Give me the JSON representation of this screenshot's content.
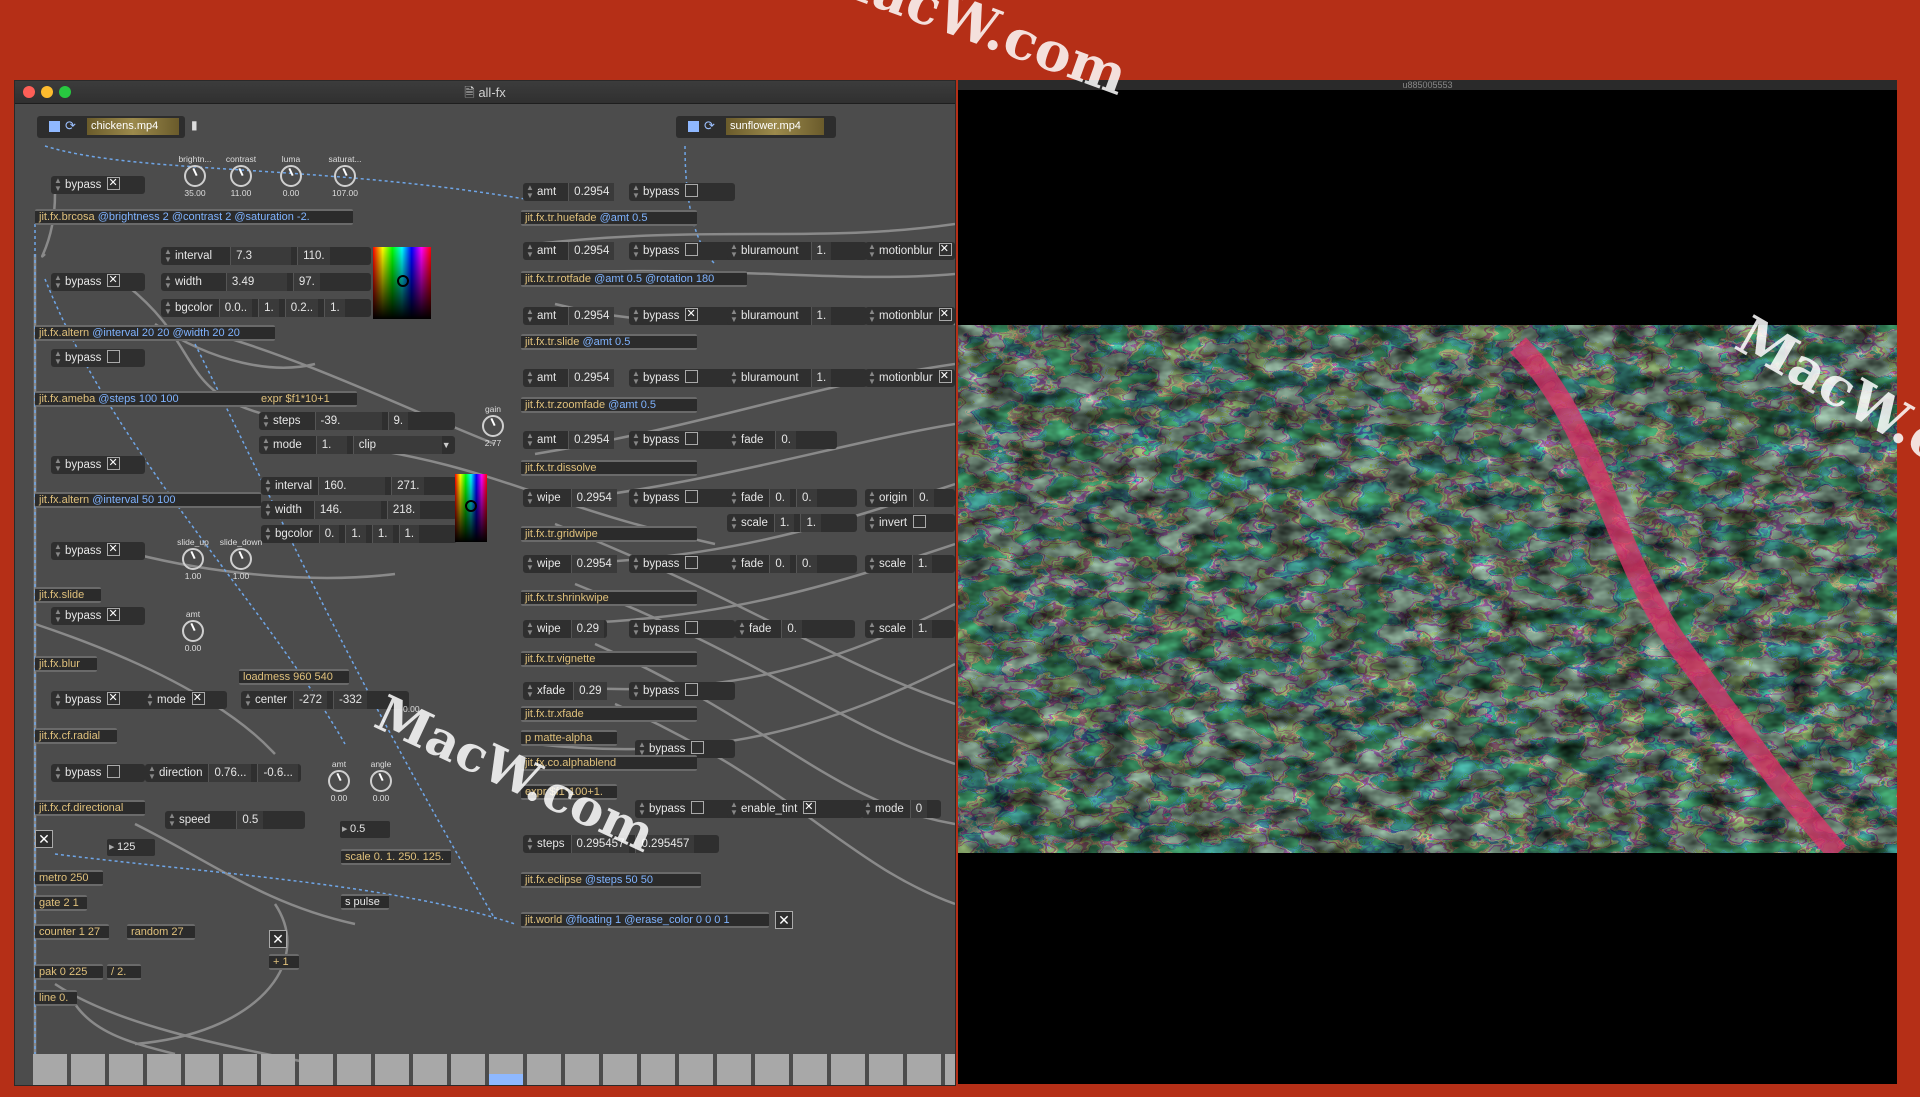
{
  "window": {
    "title": "all-fx",
    "viewer_title": "u885005553"
  },
  "watermark": "MacW.com",
  "players": [
    {
      "file": "chickens.mp4"
    },
    {
      "file": "sunflower.mp4"
    }
  ],
  "dials_top": [
    {
      "label": "brightn...",
      "value": "35.00"
    },
    {
      "label": "contrast",
      "value": "11.00"
    },
    {
      "label": "luma",
      "value": "0.00"
    },
    {
      "label": "saturat...",
      "value": "107.00"
    }
  ],
  "left_chain": {
    "bypass": "bypass",
    "brcosa": {
      "name": "jit.fx.brcosa",
      "attrs": " @brightness 2 @contrast 2 @saturation -2."
    },
    "interval_label": "interval",
    "interval_a": "7.3",
    "interval_b": "110.",
    "width_label": "width",
    "width_a": "3.49",
    "width_b": "97.",
    "bgcolor_label": "bgcolor",
    "bgcolor_a": "0.0..",
    "bgcolor_b": "1.",
    "bgcolor_c": "0.2..",
    "bgcolor_d": "1.",
    "altern1": {
      "name": "jit.fx.altern",
      "attrs": " @interval 20 20 @width 20 20"
    },
    "ameba": {
      "name": "jit.fx.ameba",
      "attrs": " @steps 100 100"
    },
    "expr1": "expr $f1*10+1",
    "steps_label": "steps",
    "steps_a": "-39.",
    "steps_b": "9.",
    "mode_label": "mode",
    "mode_a": "1.",
    "mode_b": "clip",
    "gain_label": "gain",
    "gain_value": "2.77",
    "interval2_a": "160.",
    "interval2_b": "271.",
    "width2_a": "146.",
    "width2_b": "218.",
    "bgcolor2_a": "0.",
    "bgcolor2_b": "1.",
    "bgcolor2_c": "1.",
    "bgcolor2_d": "1.",
    "altern2": {
      "name": "jit.fx.altern",
      "attrs": " @interval 50 100"
    },
    "slide_up_label": "slide_up",
    "slide_up_value": "1.00",
    "slide_down_label": "slide_down",
    "slide_down_value": "1.00",
    "slide": "jit.fx.slide",
    "amt_label": "amt",
    "amt_value": "0.00",
    "blur": "jit.fx.blur",
    "loadmess": "loadmess 960 540",
    "center_label": "center",
    "center_a": "-272",
    "center_b": "-332",
    "radial_dial_value": "0.00",
    "radial": "jit.fx.cf.radial",
    "direction_label": "direction",
    "direction_a": "0.76...",
    "direction_b": "-0.6...",
    "angle_label": "angle",
    "dir_amt_value": "0.00",
    "angle_value": "0.00",
    "directional": "jit.fx.cf.directional",
    "speed_label": "speed",
    "speed_value": "0.5",
    "speed_num": "0.5",
    "num125": "125",
    "scale_obj": "scale 0. 1. 250. 125.",
    "metro": "metro 250",
    "gate": "gate 2 1",
    "counter": "counter 1 27",
    "random": "random 27",
    "s_pulse": "s pulse",
    "plus1": "+ 1",
    "pak": "pak 0 225",
    "div2": "/ 2.",
    "line": "line 0."
  },
  "right_chain": {
    "amt": "amt",
    "bypass": "bypass",
    "val": "0.2954",
    "huefade": {
      "name": "jit.fx.tr.huefade",
      "attrs": " @amt 0.5"
    },
    "bluramount": "bluramount",
    "one": "1.",
    "motionblur": "motionblur",
    "rotfade": {
      "name": "jit.fx.tr.rotfade",
      "attrs": " @amt 0.5 @rotation 180"
    },
    "slide": {
      "name": "jit.fx.tr.slide",
      "attrs": " @amt 0.5"
    },
    "zoomfade": {
      "name": "jit.fx.tr.zoomfade",
      "attrs": " @amt 0.5"
    },
    "fade": "fade",
    "zero": "0.",
    "dissolve": "jit.fx.tr.dissolve",
    "wipe": "wipe",
    "origin": "origin",
    "scale": "scale",
    "invert": "invert",
    "gridwipe": "jit.fx.tr.gridwipe",
    "shrinkwipe": "jit.fx.tr.shrinkwipe",
    "wipe_val": "0.29",
    "vignette": "jit.fx.tr.vignette",
    "xfade": "xfade",
    "xfade_val": "0.29",
    "xfade_obj": "jit.fx.tr.xfade",
    "p_matte": "p matte-alpha",
    "alphablend": "jit.fx.co.alphablend",
    "expr2": "expr $f1*100+1.",
    "enable_tint": "enable_tint",
    "mode": "mode",
    "mode_val": "0",
    "steps": "steps",
    "steps_a": "0.295457",
    "steps_b": "0.295457",
    "eclipse": {
      "name": "jit.fx.eclipse",
      "attrs": " @steps 50 50"
    },
    "world": {
      "name": "jit.world",
      "attrs": " @floating 1 @erase_color 0 0 0 1"
    }
  },
  "multislider": {
    "values": [
      0,
      0,
      0,
      0,
      0,
      0,
      0,
      0,
      0,
      0,
      0,
      0.22,
      0.5,
      0,
      0,
      0,
      0,
      0,
      0,
      0,
      0,
      0,
      0,
      0,
      0,
      0,
      0
    ]
  }
}
